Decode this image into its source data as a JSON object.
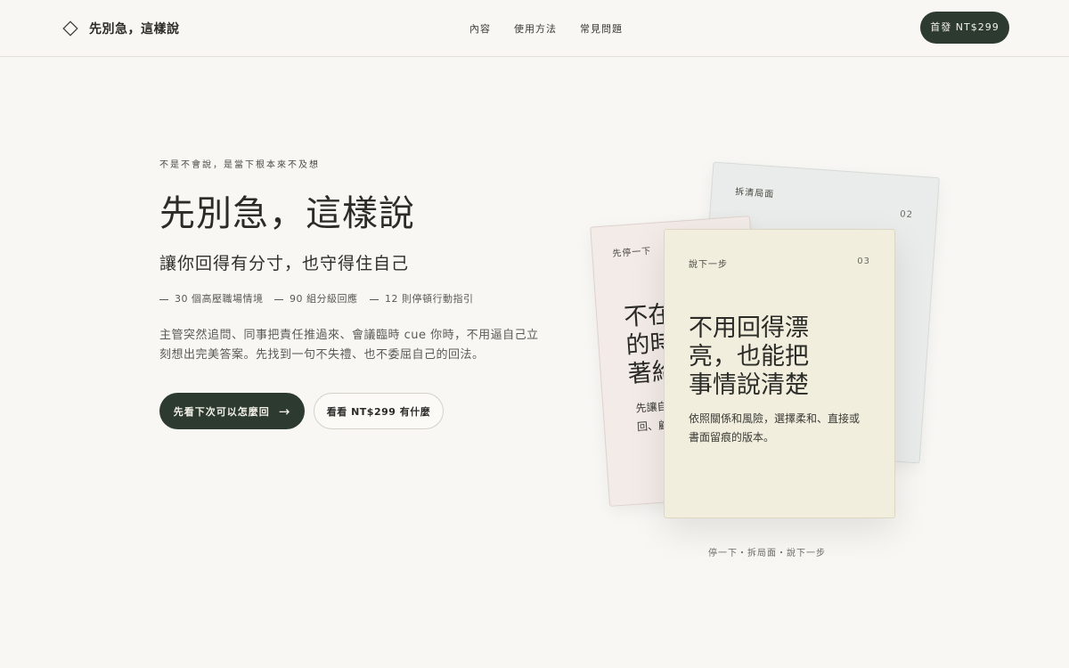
{
  "header": {
    "brand": "先別急，這樣說",
    "nav": [
      "內容",
      "使用方法",
      "常見問題"
    ],
    "cta": "首發 NT$299"
  },
  "hero": {
    "eyebrow": "不是不會說，是當下根本來不及想",
    "title": "先別急，這樣說",
    "subtitle": "讓你回得有分寸，也守得住自己",
    "stats": [
      "30 個高壓職場情境",
      "90 組分級回應",
      "12 則停頓行動指引"
    ],
    "description": "主管突然追問、同事把責任推過來、會議臨時 cue 你時，不用逼自己立刻想出完美答案。先找到一句不失禮、也不委屈自己的回法。",
    "primary_button": "先看下次可以怎麼回",
    "primary_arrow": "→",
    "secondary_button": "看看 NT$299 有什麼"
  },
  "cards": {
    "left": {
      "label": "先停一下",
      "big_line1": "不在",
      "big_line2": "的時",
      "big_line3": "著給",
      "small_line1": "先讓自",
      "small_line2": "回、顧"
    },
    "right": {
      "label": "拆清局面",
      "num": "02"
    },
    "front": {
      "label": "說下一步",
      "num": "03",
      "big_line1": "不用回得漂",
      "big_line2": "亮，也能把",
      "big_line3": "事情說清楚",
      "small_line1": "依照關係和風險，選擇柔和、直接或",
      "small_line2": "書面留痕的版本。"
    },
    "caption": "停一下・拆局面・說下一步"
  }
}
